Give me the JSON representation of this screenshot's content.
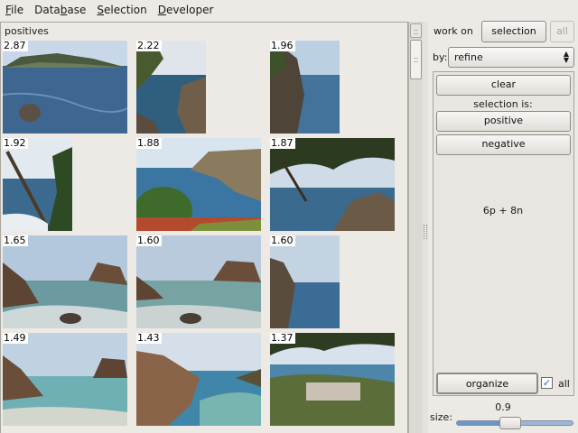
{
  "menubar": {
    "items": [
      {
        "before": "",
        "mnemonic": "F",
        "after": "ile"
      },
      {
        "before": "Data",
        "mnemonic": "b",
        "after": "ase"
      },
      {
        "before": "",
        "mnemonic": "S",
        "after": "election"
      },
      {
        "before": "",
        "mnemonic": "D",
        "after": "eveloper"
      }
    ]
  },
  "results": {
    "section_label": "positives",
    "thumbnails": [
      {
        "score": "2.87",
        "scene": "cliff-sea"
      },
      {
        "score": "2.22",
        "scene": "rocky-cove"
      },
      {
        "score": "1.96",
        "scene": "tall-rock"
      },
      {
        "score": "1.92",
        "scene": "pine-shore"
      },
      {
        "score": "1.88",
        "scene": "bay-cliffs"
      },
      {
        "score": "1.87",
        "scene": "tree-frame"
      },
      {
        "score": "1.65",
        "scene": "beach-waves"
      },
      {
        "score": "1.60",
        "scene": "beach-calm"
      },
      {
        "score": "1.60",
        "scene": "rock-sky"
      },
      {
        "score": "1.49",
        "scene": "turquoise-beach"
      },
      {
        "score": "1.43",
        "scene": "cove-cliff"
      },
      {
        "score": "1.37",
        "scene": "harbor-town"
      }
    ]
  },
  "controls": {
    "work_on_label": "work on",
    "selection_button": "selection",
    "all_button": "all",
    "by_label": "by:",
    "by_value": "refine",
    "clear_button": "clear",
    "selection_is_label": "selection is:",
    "positive_button": "positive",
    "negative_button": "negative",
    "counts": "6p + 8n",
    "organize_button": "organize",
    "all_checkbox_label": "all",
    "all_checked": true,
    "zoom_value": "0.9",
    "size_label": "size:",
    "size_fraction": 0.45
  },
  "colors": {
    "accent": "#6f95c4",
    "window_bg": "#edeae6"
  }
}
